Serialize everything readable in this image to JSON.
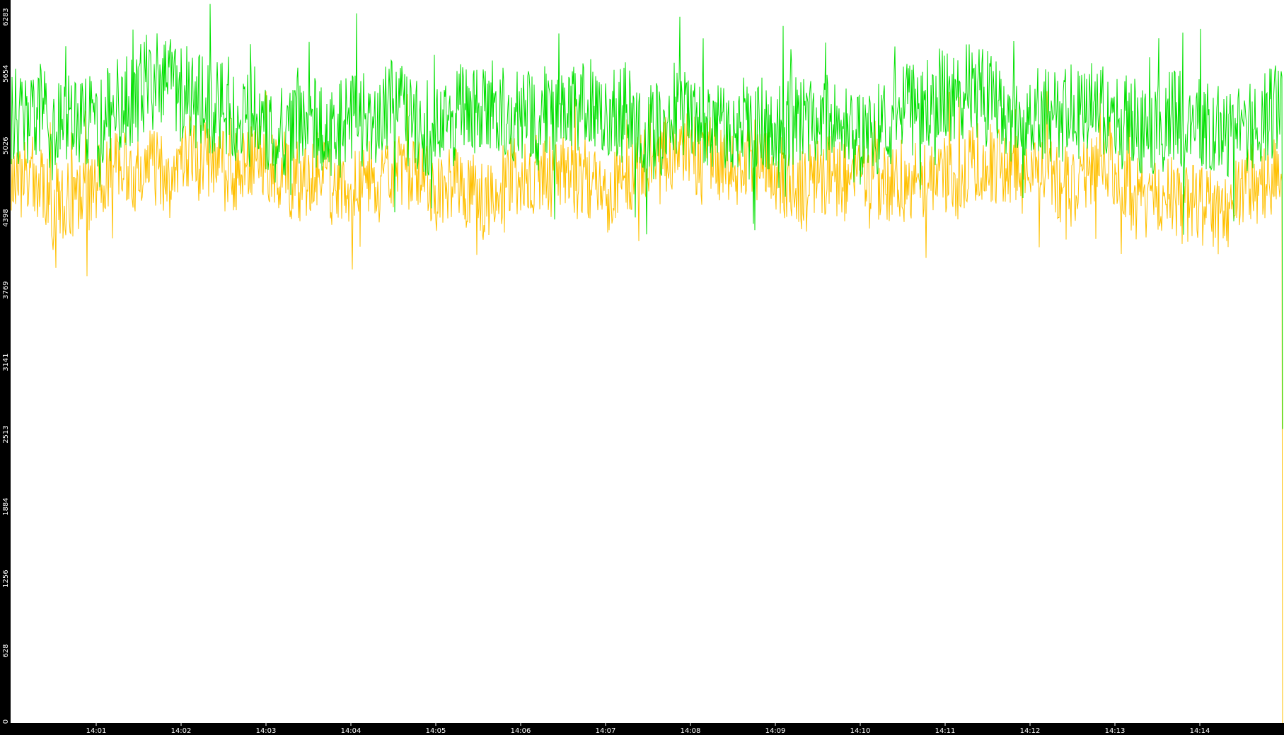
{
  "chart_data": {
    "type": "line",
    "title": "",
    "xlabel": "",
    "ylabel": "",
    "x_start": "14:00",
    "x_end": "14:15",
    "x_ticks": [
      "14:01",
      "14:02",
      "14:03",
      "14:04",
      "14:05",
      "14:06",
      "14:07",
      "14:08",
      "14:09",
      "14:10",
      "14:11",
      "14:12",
      "14:13",
      "14:14"
    ],
    "y_ticks": [
      "0",
      "628",
      "1256",
      "1884",
      "2513",
      "3141",
      "3769",
      "4398",
      "5026",
      "5654",
      "6283"
    ],
    "ylim": [
      0,
      6283
    ],
    "grid": false,
    "legend": "none",
    "series": [
      {
        "color": "#00e000",
        "mean_y": 5300,
        "spread_y": 420,
        "min_y": 4000,
        "max_y": 6283,
        "end_drop_y": 2560
      },
      {
        "color": "#ffc000",
        "mean_y": 4700,
        "spread_y": 350,
        "min_y": 3200,
        "max_y": 5500,
        "end_drop_y": 0
      }
    ]
  },
  "colors": {
    "background": "#ffffff",
    "axis_band": "#000000",
    "axis_text": "#ffffff",
    "green_series": "#00e000",
    "orange_series": "#ffc000"
  }
}
